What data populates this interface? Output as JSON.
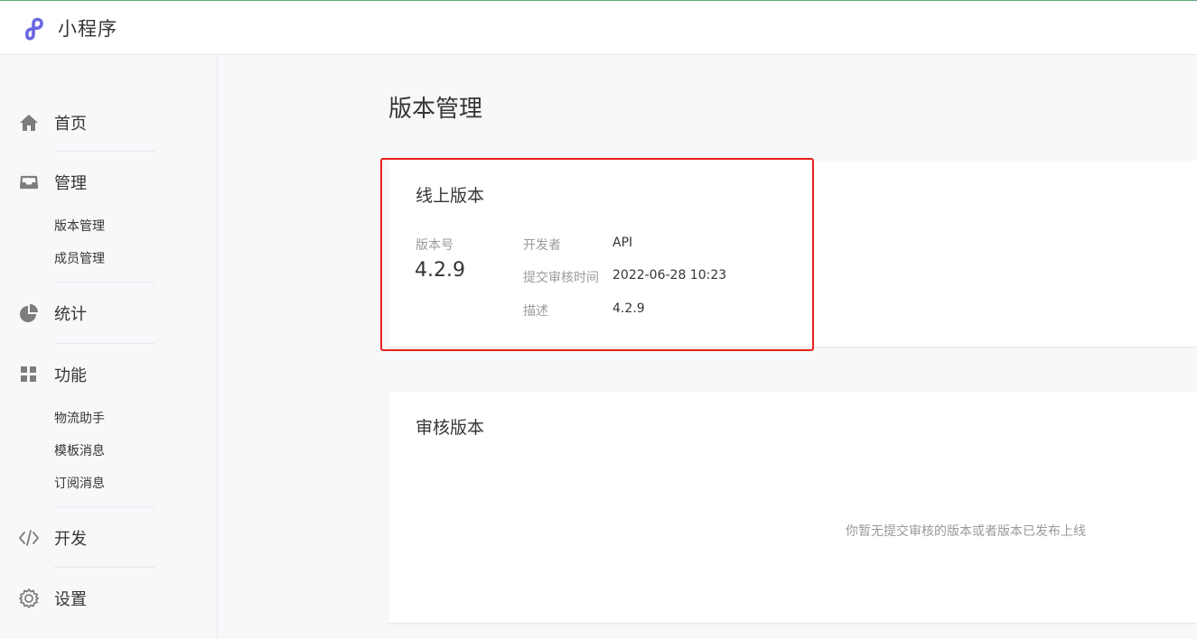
{
  "app": {
    "name": "小程序",
    "accent": "#6b66e0"
  },
  "sidebar": {
    "home": {
      "label": "首页",
      "icon": "home-icon"
    },
    "manage": {
      "label": "管理",
      "icon": "inbox-icon",
      "items": [
        {
          "label": "版本管理"
        },
        {
          "label": "成员管理"
        }
      ]
    },
    "stats": {
      "label": "统计",
      "icon": "pie-chart-icon"
    },
    "features": {
      "label": "功能",
      "icon": "grid-icon",
      "items": [
        {
          "label": "物流助手"
        },
        {
          "label": "模板消息"
        },
        {
          "label": "订阅消息"
        }
      ]
    },
    "develop": {
      "label": "开发",
      "icon": "code-icon"
    },
    "settings": {
      "label": "设置",
      "icon": "gear-icon"
    }
  },
  "main": {
    "title": "版本管理",
    "online": {
      "title": "线上版本",
      "version_label": "版本号",
      "version_value": "4.2.9",
      "developer_label": "开发者",
      "developer_value": "API",
      "submit_time_label": "提交审核时间",
      "submit_time_value": "2022-06-28 10:23",
      "desc_label": "描述",
      "desc_value": "4.2.9"
    },
    "audit": {
      "title": "审核版本",
      "empty_text": "你暂无提交审核的版本或者版本已发布上线"
    }
  },
  "colors": {
    "highlight_border": "#e8201b",
    "page_background": "#f7f8fa",
    "text_primary": "#353535",
    "text_secondary": "#9a9a9a"
  }
}
